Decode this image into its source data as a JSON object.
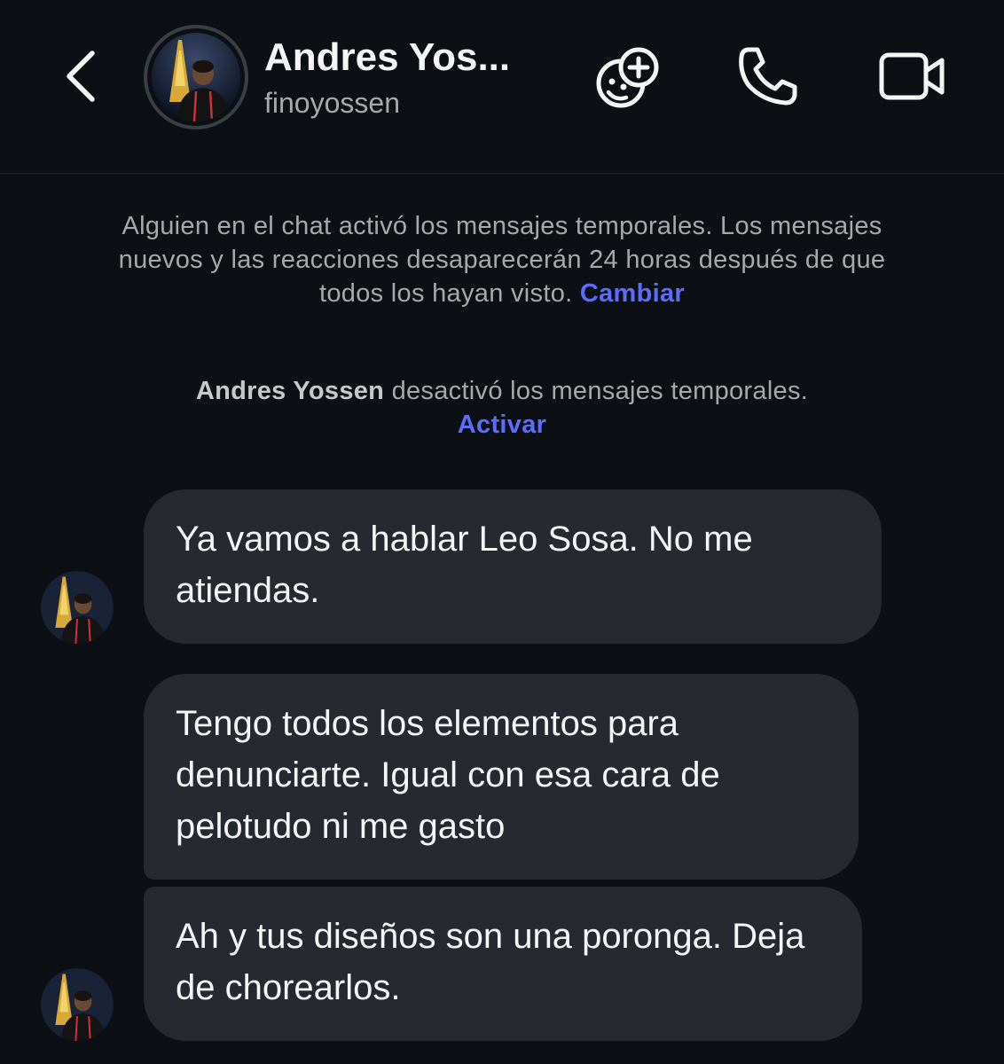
{
  "header": {
    "back_icon": "chevron-left-icon",
    "contact_name": "Andres Yos...",
    "username": "finoyossen",
    "icons": [
      "sticker-effects-icon",
      "phone-icon",
      "video-camera-icon"
    ]
  },
  "notices": {
    "temp_on": {
      "text": "Alguien en el chat activó los mensajes temporales. Los mensajes nuevos y las reacciones desaparecerán 24 horas después de que todos los hayan visto.",
      "link": "Cambiar"
    },
    "temp_off": {
      "name": "Andres Yossen",
      "text": "desactivó los mensajes temporales.",
      "link": "Activar"
    }
  },
  "messages": [
    {
      "text": "Ya vamos a hablar Leo Sosa. No me atiendas."
    },
    {
      "text": "Tengo todos los elementos para denunciarte. Igual con esa cara de pelotudo ni me gasto"
    },
    {
      "text": "Ah y tus diseños son una poronga. Deja de chorearlos."
    }
  ],
  "colors": {
    "background": "#0c1014",
    "bubble": "#262a30",
    "link": "#5b6cff",
    "secondary_text": "#a8a8a8"
  }
}
